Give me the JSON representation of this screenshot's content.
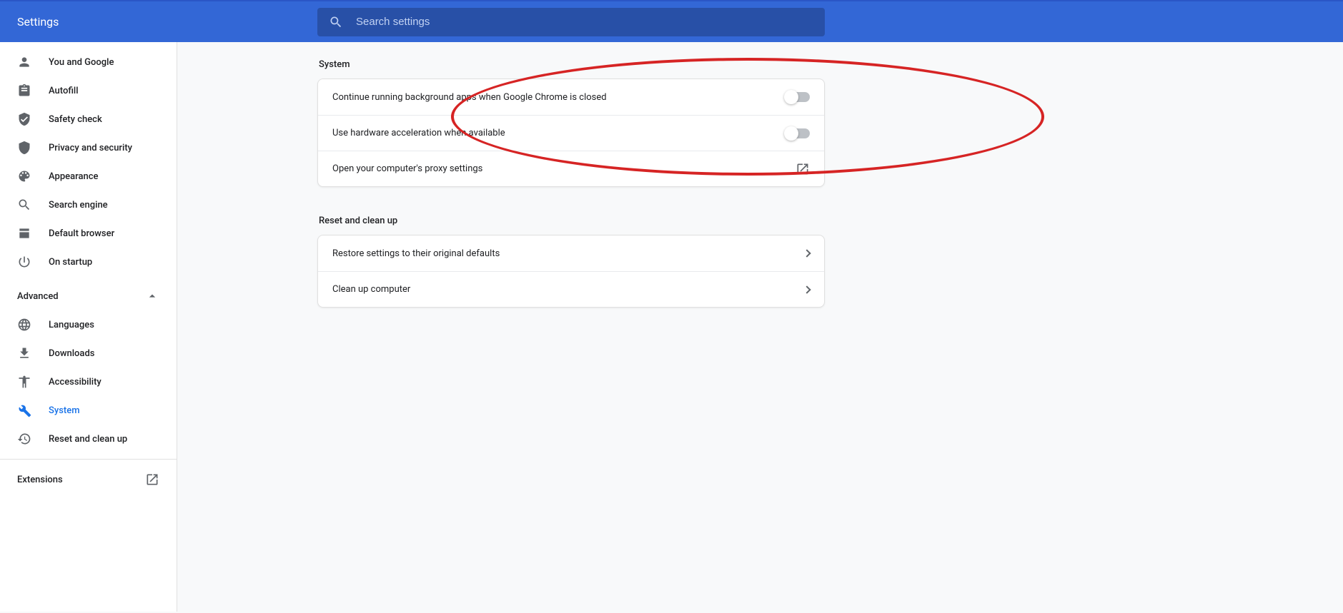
{
  "header": {
    "title": "Settings",
    "search_placeholder": "Search settings"
  },
  "sidebar": {
    "items": [
      {
        "id": "you",
        "label": "You and Google",
        "icon": "person-icon"
      },
      {
        "id": "autofill",
        "label": "Autofill",
        "icon": "clipboard-icon"
      },
      {
        "id": "safety",
        "label": "Safety check",
        "icon": "verified-icon"
      },
      {
        "id": "privacy",
        "label": "Privacy and security",
        "icon": "shield-icon"
      },
      {
        "id": "appearance",
        "label": "Appearance",
        "icon": "palette-icon"
      },
      {
        "id": "search",
        "label": "Search engine",
        "icon": "search-icon"
      },
      {
        "id": "default",
        "label": "Default browser",
        "icon": "browser-icon"
      },
      {
        "id": "startup",
        "label": "On startup",
        "icon": "power-icon"
      }
    ],
    "advanced_label": "Advanced",
    "advanced_items": [
      {
        "id": "languages",
        "label": "Languages",
        "icon": "globe-icon"
      },
      {
        "id": "downloads",
        "label": "Downloads",
        "icon": "download-icon"
      },
      {
        "id": "accessibility",
        "label": "Accessibility",
        "icon": "accessibility-icon"
      },
      {
        "id": "system",
        "label": "System",
        "icon": "wrench-icon",
        "active": true
      },
      {
        "id": "reset",
        "label": "Reset and clean up",
        "icon": "restore-icon"
      }
    ],
    "extensions_label": "Extensions"
  },
  "sections": {
    "system": {
      "title": "System",
      "rows": [
        {
          "label": "Continue running background apps when Google Chrome is closed",
          "type": "toggle",
          "value": false
        },
        {
          "label": "Use hardware acceleration when available",
          "type": "toggle",
          "value": false
        },
        {
          "label": "Open your computer's proxy settings",
          "type": "launch"
        }
      ]
    },
    "reset": {
      "title": "Reset and clean up",
      "rows": [
        {
          "label": "Restore settings to their original defaults",
          "type": "arrow"
        },
        {
          "label": "Clean up computer",
          "type": "arrow"
        }
      ]
    }
  }
}
